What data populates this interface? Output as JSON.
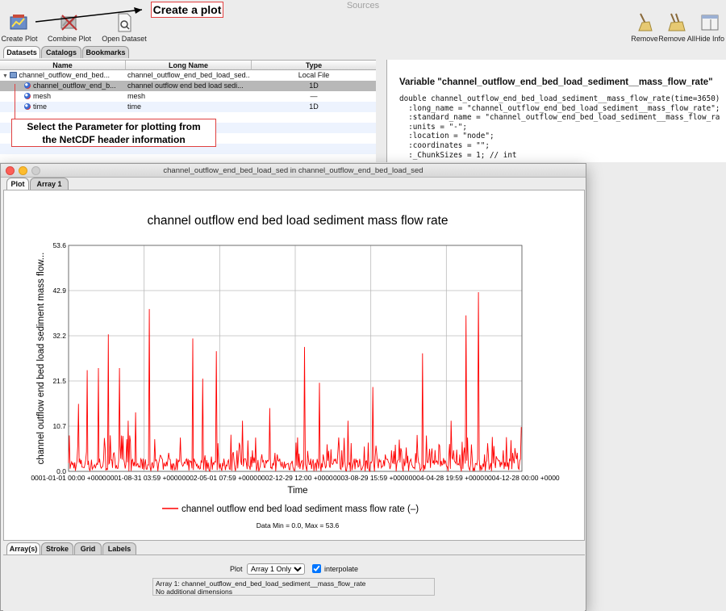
{
  "window": {
    "title": "Sources"
  },
  "toolbar": {
    "left": [
      {
        "label": "Create Plot",
        "icon": "create-plot-icon"
      },
      {
        "label": "Combine Plot",
        "icon": "combine-plot-icon"
      },
      {
        "label": "Open Dataset",
        "icon": "open-dataset-icon"
      }
    ],
    "right": [
      {
        "label": "Remove",
        "icon": "broom-icon"
      },
      {
        "label": "Remove All",
        "icon": "broom-double-icon"
      },
      {
        "label": "Hide Info",
        "icon": "hide-info-icon"
      }
    ]
  },
  "tabs": [
    "Datasets",
    "Catalogs",
    "Bookmarks"
  ],
  "table": {
    "columns": [
      "Name",
      "Long Name",
      "Type"
    ],
    "rows": [
      {
        "name": "channel_outflow_end_bed...",
        "long_name": "channel_outflow_end_bed_load_sed...",
        "type": "Local File"
      },
      {
        "name": "channel_outflow_end_b...",
        "long_name": "channel outflow end bed load sedi...",
        "type": "1D"
      },
      {
        "name": "mesh",
        "long_name": "mesh",
        "type": "—"
      },
      {
        "name": "time",
        "long_name": "time",
        "type": "1D"
      }
    ]
  },
  "info": {
    "heading": "Variable \"channel_outflow_end_bed_load_sediment__mass_flow_rate\"",
    "lines": [
      "double channel_outflow_end_bed_load_sediment__mass_flow_rate(time=3650)",
      "  :long_name = \"channel_outflow_end_bed_load_sediment__mass_flow_rate\";",
      "  :standard_name = \"channel_outflow_end_bed_load_sediment__mass_flow_ra",
      "  :units = \"-\";",
      "  :location = \"node\";",
      "  :coordinates = \"\";",
      "  :_ChunkSizes = 1; // int"
    ]
  },
  "annotations": {
    "create_plot": "Create a plot",
    "select_param_1": "Select the Parameter for plotting from",
    "select_param_2": "the NetCDF header information"
  },
  "plot_window": {
    "title": "channel_outflow_end_bed_load_sed in channel_outflow_end_bed_load_sed",
    "tabs": [
      "Plot",
      "Array 1"
    ],
    "bottom_tabs": [
      "Array(s)",
      "Stroke",
      "Grid",
      "Labels"
    ],
    "plot_label": "Plot",
    "plot_select": "Array 1 Only",
    "interpolate_label": "interpolate",
    "interpolate_checked": true,
    "array_info_1": "Array 1: channel_outflow_end_bed_load_sediment__mass_flow_rate",
    "array_info_2": "No additional dimensions",
    "stats": "Data Min = 0.0, Max = 53.6"
  },
  "chart_data": {
    "type": "line",
    "title": "channel outflow end bed load sediment  mass flow rate",
    "xlabel": "Time",
    "ylabel": "channel outflow end bed load sediment  mass flow...",
    "legend": "channel outflow end bed load sediment  mass flow rate (–)",
    "legend_position": "bottom-center",
    "grid": true,
    "color": "#ff0000",
    "ylim": [
      0,
      53.6
    ],
    "yticks": [
      "0.0",
      "10.7",
      "21.5",
      "32.2",
      "42.9",
      "53.6"
    ],
    "xticks": [
      "0001-01-01 00:00 +0000",
      "0001-08-31 03:59 +0000",
      "0002-05-01 07:59 +0000",
      "0002-12-29 12:00 +0000",
      "0003-08-29 15:59 +0000",
      "0004-04-28 19:59 +0000",
      "0004-12-28 00:00 +0000"
    ],
    "x": [
      0,
      80,
      90,
      150,
      160,
      240,
      250,
      320,
      330,
      360,
      410,
      420,
      480,
      540,
      600,
      650,
      700,
      800,
      900,
      1000,
      1010,
      1080,
      1150,
      1190,
      1240,
      1250,
      1320,
      1380,
      1400,
      1420,
      1480,
      1500,
      1550,
      1620,
      1680,
      1700,
      1800,
      1900,
      1950,
      2020,
      2050,
      2150,
      2200,
      2250,
      2300,
      2400,
      2450,
      2500,
      2550,
      2600,
      2700,
      2750,
      2850,
      2900,
      2920,
      3000,
      3080,
      3100,
      3150,
      3200,
      3250,
      3300,
      3380,
      3450,
      3500,
      3550,
      3600,
      3645
    ],
    "values": [
      2.0,
      16.0,
      3.0,
      24.0,
      2.5,
      24.5,
      3.0,
      32.5,
      2.0,
      4.0,
      24.5,
      3.0,
      12.0,
      14.0,
      3.0,
      38.5,
      2.5,
      3.0,
      8.0,
      31.5,
      3.0,
      22.0,
      3.5,
      28.5,
      2.0,
      3.0,
      4.0,
      6.0,
      12.0,
      3.0,
      5.0,
      2.0,
      3.0,
      15.0,
      4.0,
      3.0,
      2.5,
      29.5,
      3.0,
      21.0,
      4.0,
      3.0,
      5.0,
      12.0,
      3.0,
      2.5,
      20.0,
      3.0,
      4.0,
      5.0,
      3.0,
      2.5,
      28.0,
      3.0,
      4.0,
      2.5,
      12.0,
      5.0,
      4.0,
      37.0,
      3.0,
      42.5,
      4.0,
      3.0,
      5.0,
      3.0,
      4.0,
      10.5
    ]
  }
}
